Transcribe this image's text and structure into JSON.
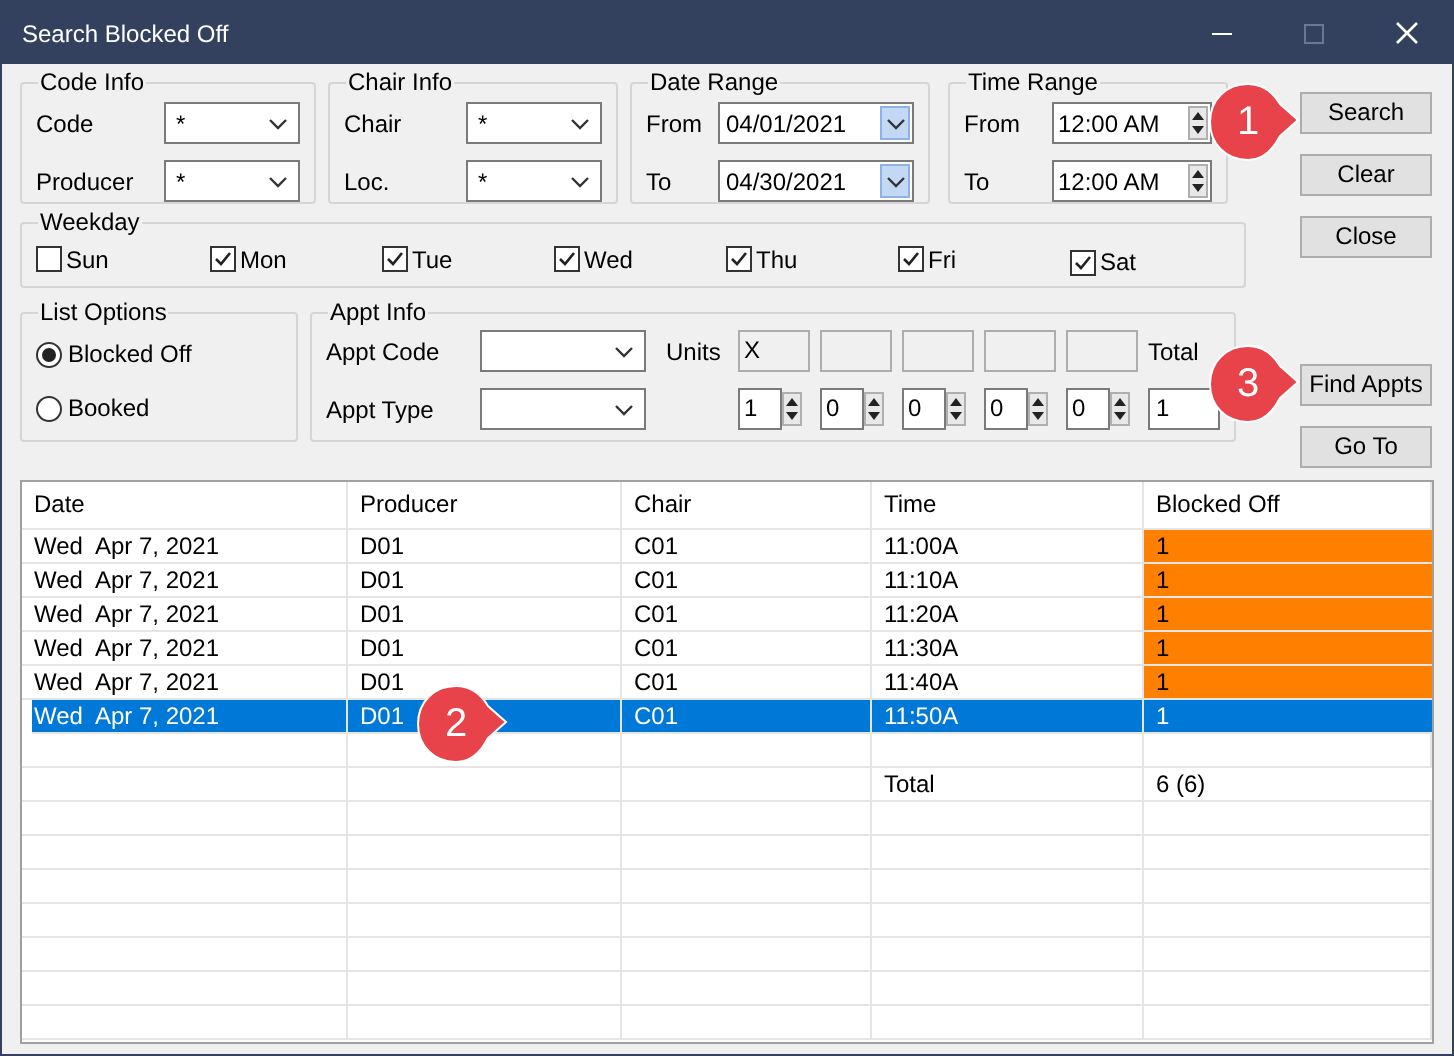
{
  "window": {
    "title": "Search Blocked Off"
  },
  "code_info": {
    "title": "Code Info",
    "fields": [
      {
        "label": "Code",
        "value": "*"
      },
      {
        "label": "Producer",
        "value": "*"
      }
    ]
  },
  "chair_info": {
    "title": "Chair Info",
    "fields": [
      {
        "label": "Chair",
        "value": "*"
      },
      {
        "label": "Loc.",
        "value": "*"
      }
    ]
  },
  "date_range": {
    "title": "Date Range",
    "fields": [
      {
        "label": "From",
        "value": "04/01/2021"
      },
      {
        "label": "To",
        "value": "04/30/2021"
      }
    ]
  },
  "time_range": {
    "title": "Time Range",
    "fields": [
      {
        "label": "From",
        "value": "12:00 AM"
      },
      {
        "label": "To",
        "value": "12:00 AM"
      }
    ]
  },
  "top_buttons": [
    "Search",
    "Clear",
    "Close"
  ],
  "weekday": {
    "title": "Weekday",
    "days": [
      {
        "label": "Sun",
        "checked": false
      },
      {
        "label": "Mon",
        "checked": true
      },
      {
        "label": "Tue",
        "checked": true
      },
      {
        "label": "Wed",
        "checked": true
      },
      {
        "label": "Thu",
        "checked": true
      },
      {
        "label": "Fri",
        "checked": true
      },
      {
        "label": "Sat",
        "checked": true
      }
    ]
  },
  "list_options": {
    "title": "List Options",
    "options": [
      {
        "label": "Blocked Off",
        "selected": true
      },
      {
        "label": "Booked",
        "selected": false
      }
    ]
  },
  "appt_info": {
    "title": "Appt Info",
    "fields": [
      {
        "label": "Appt Code"
      },
      {
        "label": "Appt Type"
      }
    ],
    "units_label": "Units",
    "units": [
      {
        "mark": "X",
        "count": "1"
      },
      {
        "count": "0"
      },
      {
        "count": "0"
      },
      {
        "count": "0"
      },
      {
        "count": "0"
      }
    ],
    "total_label": "Total",
    "total_value": "1"
  },
  "bottom_buttons": [
    "Find Appts",
    "Go To"
  ],
  "table": {
    "columns": [
      "Date",
      "Producer",
      "Chair",
      "Time",
      "Blocked Off"
    ],
    "rows": [
      {
        "cells": [
          "Wed  Apr 7, 2021",
          "D01",
          "C01",
          "11:00A",
          "1"
        ],
        "selected": false,
        "flagged": true
      },
      {
        "cells": [
          "Wed  Apr 7, 2021",
          "D01",
          "C01",
          "11:10A",
          "1"
        ],
        "selected": false,
        "flagged": true
      },
      {
        "cells": [
          "Wed  Apr 7, 2021",
          "D01",
          "C01",
          "11:20A",
          "1"
        ],
        "selected": false,
        "flagged": true
      },
      {
        "cells": [
          "Wed  Apr 7, 2021",
          "D01",
          "C01",
          "11:30A",
          "1"
        ],
        "selected": false,
        "flagged": true
      },
      {
        "cells": [
          "Wed  Apr 7, 2021",
          "D01",
          "C01",
          "11:40A",
          "1"
        ],
        "selected": false,
        "flagged": true
      },
      {
        "cells": [
          "Wed  Apr 7, 2021",
          "D01",
          "C01",
          "11:50A",
          "1"
        ],
        "selected": true
      }
    ],
    "total_label": "Total",
    "total_value": "6 (6)"
  },
  "callouts": [
    {
      "number": "1"
    },
    {
      "number": "2"
    },
    {
      "number": "3"
    }
  ]
}
